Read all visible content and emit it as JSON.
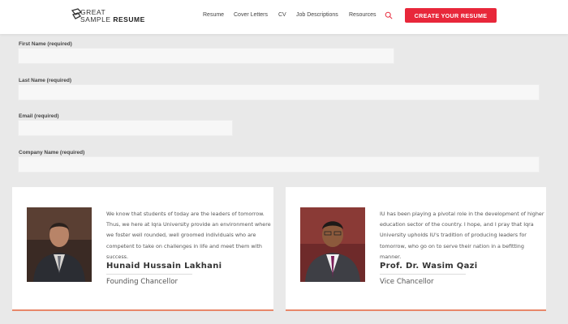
{
  "header": {
    "logo": {
      "line1": "GREAT",
      "line2_a": "SAMPLE",
      "line2_b": "RESUME"
    },
    "nav": [
      {
        "label": "Resume"
      },
      {
        "label": "Cover Letters"
      },
      {
        "label": "CV"
      },
      {
        "label": "Job Descriptions"
      },
      {
        "label": "Resources"
      }
    ],
    "search_icon": "search-icon",
    "cta_label": "CREATE YOUR RESUME",
    "accent_color": "#e8273a"
  },
  "form": {
    "first_name_label": "First Name (required)",
    "last_name_label": "Last Name (required)",
    "email_label": "Email (required)",
    "company_label": "Company Name (required)",
    "first_name_value": "",
    "last_name_value": "",
    "email_value": "",
    "company_value": ""
  },
  "cards": [
    {
      "quote": "We know that students of today are the leaders of tomorrow. Thus, we here at Iqra University provide an environment where we foster well rounded, well groomed individuals who are competent to take on challenges in life and meet them with success.",
      "name": "Hunaid Hussain Lakhani",
      "title": "Founding Chancellor"
    },
    {
      "quote": "IU has been playing a pivotal role in the development of higher education sector of the country. I hope, and I pray that Iqra University upholds IU's tradition of producing leaders for tomorrow, who go on to serve their nation in a befitting manner.",
      "name": "Prof. Dr. Wasim Qazi",
      "title": "Vice Chancellor"
    }
  ]
}
